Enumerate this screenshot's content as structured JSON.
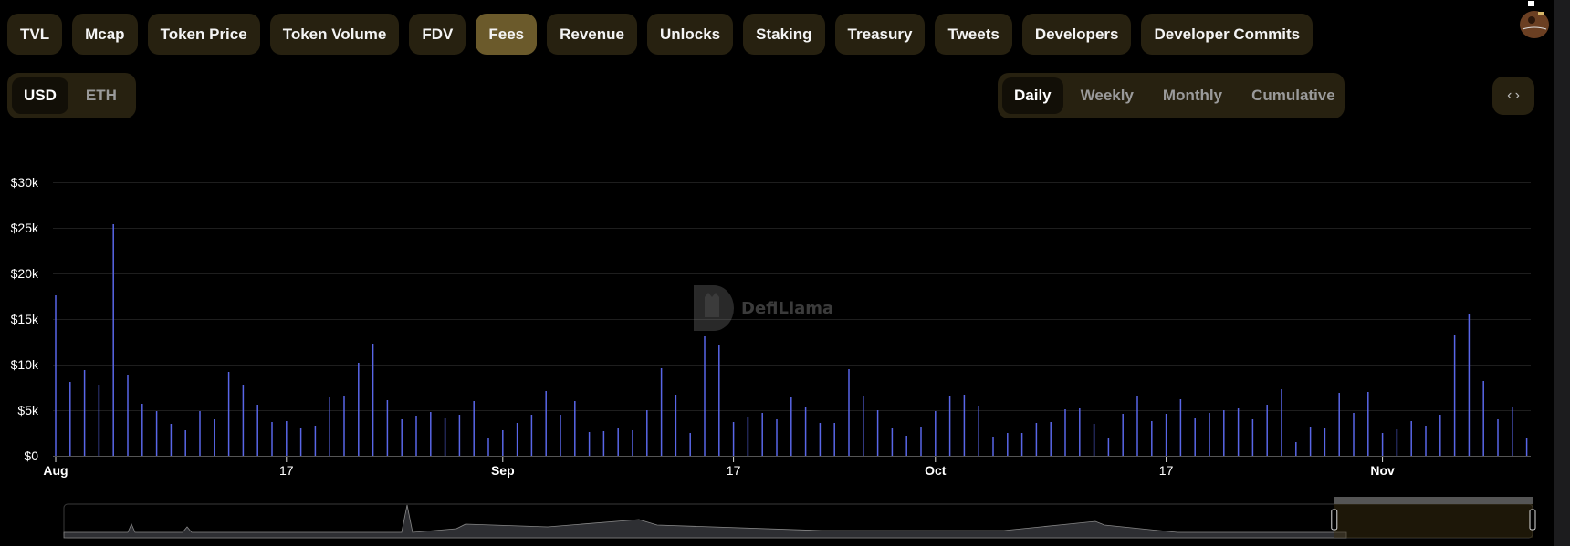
{
  "tabs": [
    {
      "label": "TVL",
      "active": false
    },
    {
      "label": "Mcap",
      "active": false
    },
    {
      "label": "Token Price",
      "active": false
    },
    {
      "label": "Token Volume",
      "active": false
    },
    {
      "label": "FDV",
      "active": false
    },
    {
      "label": "Fees",
      "active": true
    },
    {
      "label": "Revenue",
      "active": false
    },
    {
      "label": "Unlocks",
      "active": false
    },
    {
      "label": "Staking",
      "active": false
    },
    {
      "label": "Treasury",
      "active": false
    },
    {
      "label": "Tweets",
      "active": false
    },
    {
      "label": "Developers",
      "active": false
    },
    {
      "label": "Developer Commits",
      "active": false
    }
  ],
  "currency": {
    "options": [
      "USD",
      "ETH"
    ],
    "selected": "USD"
  },
  "period": {
    "options": [
      "Daily",
      "Weekly",
      "Monthly",
      "Cumulative"
    ],
    "selected": "Daily"
  },
  "embed_icon": "code-brackets-icon",
  "watermark": "DefiLlama",
  "colors": {
    "bar": "#5966e8",
    "active_tab": "#6b5a2b",
    "tab_bg": "#272110",
    "grid": "#1e1e1e"
  },
  "chart_data": {
    "type": "bar",
    "x_start": "Aug 1",
    "x_end": "Nov 11",
    "x_ticks": [
      {
        "label": "Aug",
        "day": 0,
        "bold": true
      },
      {
        "label": "17",
        "day": 16,
        "bold": false
      },
      {
        "label": "Sep",
        "day": 31,
        "bold": true
      },
      {
        "label": "17",
        "day": 47,
        "bold": false
      },
      {
        "label": "Oct",
        "day": 61,
        "bold": true
      },
      {
        "label": "17",
        "day": 77,
        "bold": false
      },
      {
        "label": "Nov",
        "day": 92,
        "bold": true
      }
    ],
    "y_ticks": [
      {
        "label": "$0",
        "value": 0
      },
      {
        "label": "$5k",
        "value": 5000
      },
      {
        "label": "$10k",
        "value": 10000
      },
      {
        "label": "$15k",
        "value": 15000
      },
      {
        "label": "$20k",
        "value": 20000
      },
      {
        "label": "$25k",
        "value": 25000
      },
      {
        "label": "$30k",
        "value": 30000
      }
    ],
    "ylim": [
      0,
      30000
    ],
    "grid": true,
    "values_k": [
      17.6,
      8.1,
      9.4,
      7.8,
      25.4,
      8.9,
      5.7,
      4.9,
      3.5,
      2.8,
      4.9,
      4.0,
      9.2,
      7.8,
      5.6,
      3.7,
      3.8,
      3.1,
      3.3,
      6.4,
      6.6,
      10.2,
      12.3,
      6.1,
      4.0,
      4.4,
      4.8,
      4.1,
      4.5,
      6.0,
      1.9,
      2.8,
      3.6,
      4.5,
      7.1,
      4.5,
      6.0,
      2.6,
      2.7,
      3.0,
      2.8,
      5.0,
      9.6,
      6.7,
      2.5,
      13.1,
      12.2,
      3.7,
      4.3,
      4.7,
      4.0,
      6.4,
      5.4,
      3.6,
      3.6,
      9.5,
      6.6,
      5.0,
      3.0,
      2.2,
      3.2,
      4.9,
      6.6,
      6.7,
      5.5,
      2.1,
      2.5,
      2.5,
      3.6,
      3.7,
      5.1,
      5.2,
      3.5,
      2.0,
      4.6,
      6.6,
      3.8,
      4.6,
      6.2,
      4.1,
      4.7,
      5.0,
      5.2,
      4.0,
      5.6,
      7.3,
      1.5,
      3.2,
      3.1,
      6.9,
      4.7,
      7.0,
      2.5,
      2.9,
      3.8,
      3.3,
      4.5,
      13.2,
      15.6,
      8.2,
      4.0,
      5.3,
      2.0
    ]
  },
  "navigator": {
    "selection_start_fraction": 0.865,
    "selection_end_fraction": 1.0
  }
}
